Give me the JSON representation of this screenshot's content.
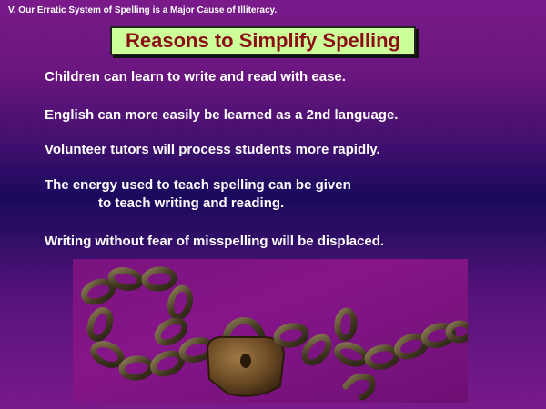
{
  "slide": {
    "header": "V.  Our Erratic System of Spelling is a Major Cause of Illiteracy.",
    "title": "Reasons to Simplify Spelling",
    "reasons": [
      {
        "text": "Children can learn to write and read with ease."
      },
      {
        "text": "English can more easily be learned as a 2nd language."
      },
      {
        "text": "Volunteer tutors will process students more rapidly."
      },
      {
        "text": "The energy used to teach spelling can be given",
        "continuation": "to teach writing and reading."
      },
      {
        "text": "Writing without fear of misspelling will be displaced."
      }
    ],
    "image_icon": "chain-and-padlock-icon"
  },
  "colors": {
    "title_box_bg": "#ccff99",
    "title_text": "#8b0f16",
    "body_text": "#ffffff",
    "background_top": "#7a1a8a",
    "background_mid": "#1a0a5e"
  }
}
